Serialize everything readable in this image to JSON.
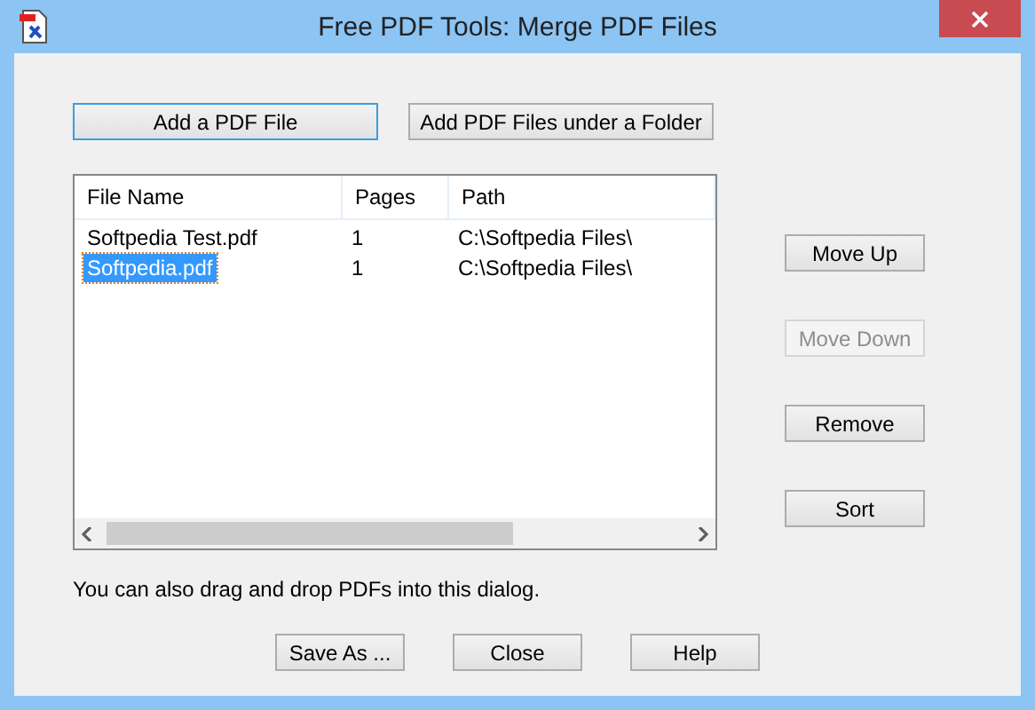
{
  "window": {
    "title": "Free PDF Tools: Merge PDF Files"
  },
  "top_buttons": [
    {
      "label": "Add a PDF File",
      "focused": true
    },
    {
      "label": "Add PDF Files under a Folder",
      "focused": false
    }
  ],
  "table": {
    "columns": [
      "File Name",
      "Pages",
      "Path"
    ],
    "rows": [
      {
        "cells": [
          "Softpedia Test.pdf",
          "1",
          "C:\\Softpedia Files\\"
        ],
        "selected": false
      },
      {
        "cells": [
          "Softpedia.pdf",
          "1",
          "C:\\Softpedia Files\\"
        ],
        "selected": true
      }
    ]
  },
  "side_buttons": [
    {
      "label": "Move Up",
      "disabled": false
    },
    {
      "label": "Move Down",
      "disabled": true
    },
    {
      "label": "Remove",
      "disabled": false
    },
    {
      "label": "Sort",
      "disabled": false
    }
  ],
  "hint": "You can also drag and drop PDFs into this dialog.",
  "bottom_buttons": [
    "Save As ...",
    "Close",
    "Help"
  ]
}
